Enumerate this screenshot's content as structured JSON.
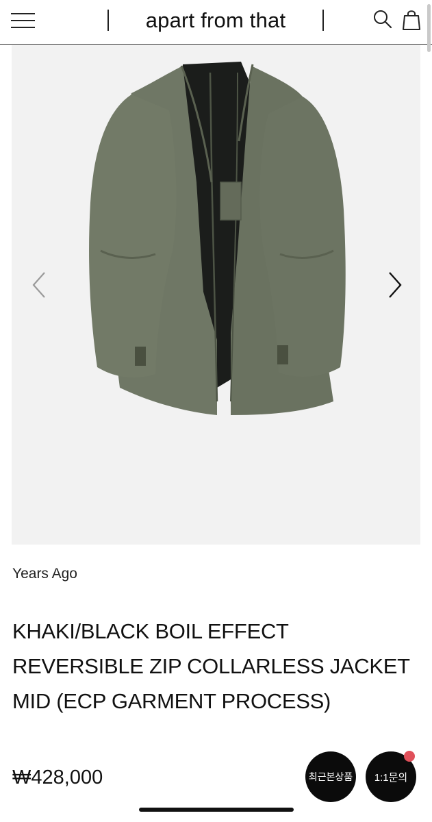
{
  "header": {
    "brand": "apart from that",
    "menu_icon": "hamburger-menu-icon",
    "search_icon": "search-icon",
    "cart_icon": "shopping-bag-icon"
  },
  "gallery": {
    "image": "khaki-collarless-jacket-photo",
    "prev_icon": "chevron-left-icon",
    "next_icon": "chevron-right-icon"
  },
  "product": {
    "brand": "Years Ago",
    "title": "KHAKI/BLACK BOIL EFFECT REVERSIBLE ZIP COLLARLESS JACKET MID (ECP GARMENT PROCESS)",
    "price": "₩428,000"
  },
  "floating": {
    "recent_label": "최근본상품",
    "chat_label": "1:1문의",
    "badge_color": "#e0505a"
  }
}
